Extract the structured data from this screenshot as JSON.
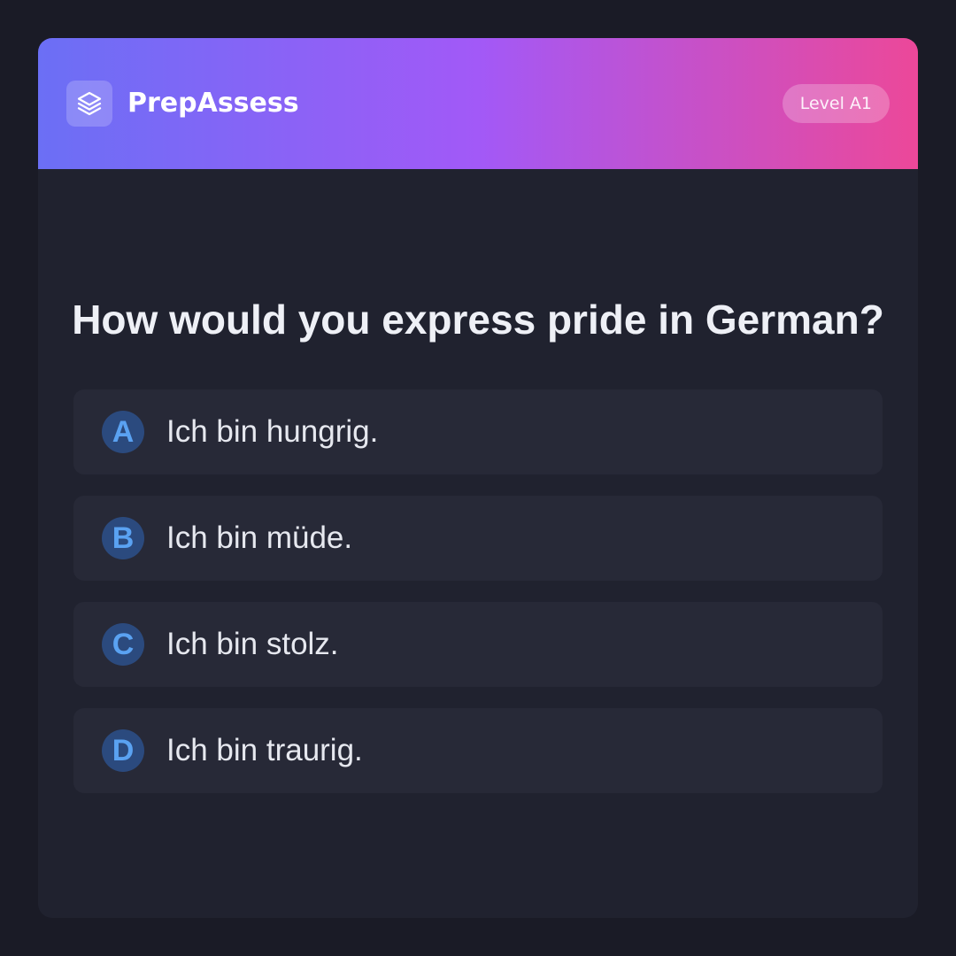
{
  "header": {
    "brand": "PrepAssess",
    "level": "Level A1",
    "logo_icon": "layers-icon",
    "gradient": [
      "#6b6ff5",
      "#a259f7",
      "#ec4899"
    ]
  },
  "quiz": {
    "question": "How would you express pride in German?",
    "options": [
      {
        "letter": "A",
        "text": "Ich bin hungrig."
      },
      {
        "letter": "B",
        "text": "Ich bin müde."
      },
      {
        "letter": "C",
        "text": "Ich bin stolz."
      },
      {
        "letter": "D",
        "text": "Ich bin traurig."
      }
    ]
  },
  "colors": {
    "background": "#1a1b26",
    "card": "#20222f",
    "option": "#272937",
    "letter_badge": "#2b4a7e",
    "letter_text": "#5aa2f2"
  }
}
